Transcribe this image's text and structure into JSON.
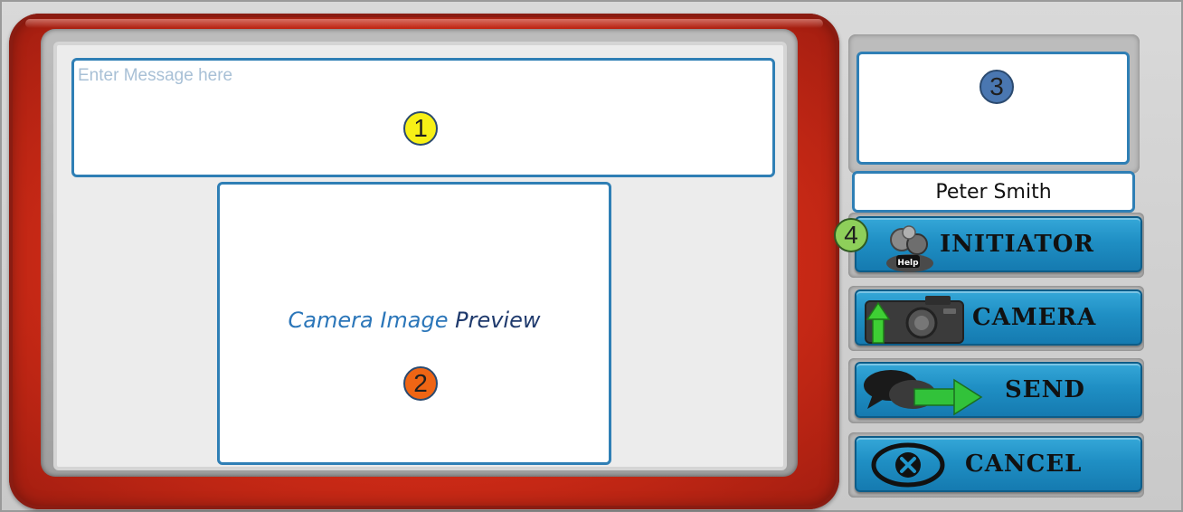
{
  "message": {
    "placeholder": "Enter Message here",
    "value": ""
  },
  "camera_preview": {
    "text_part1": "Camera Image",
    "text_part2": "Preview"
  },
  "markers": {
    "m1": "1",
    "m2": "2",
    "m3": "3",
    "m4": "4"
  },
  "contact": {
    "name": "Peter Smith"
  },
  "buttons": {
    "initiator": {
      "label": "INITIATOR",
      "icon": "help-person-icon"
    },
    "camera": {
      "label": "CAMERA",
      "icon": "camera-upload-icon"
    },
    "send": {
      "label": "SEND",
      "icon": "chat-send-icon"
    },
    "cancel": {
      "label": "CANCEL",
      "icon": "close-circle-icon"
    }
  },
  "colors": {
    "frame_red": "#cc2a16",
    "button_blue": "#1f8fc4",
    "field_border": "#2f7fb5",
    "marker1": "#f7f016",
    "marker2": "#ef6514",
    "marker3": "#4a77b1",
    "marker4": "#8ecf5a"
  }
}
